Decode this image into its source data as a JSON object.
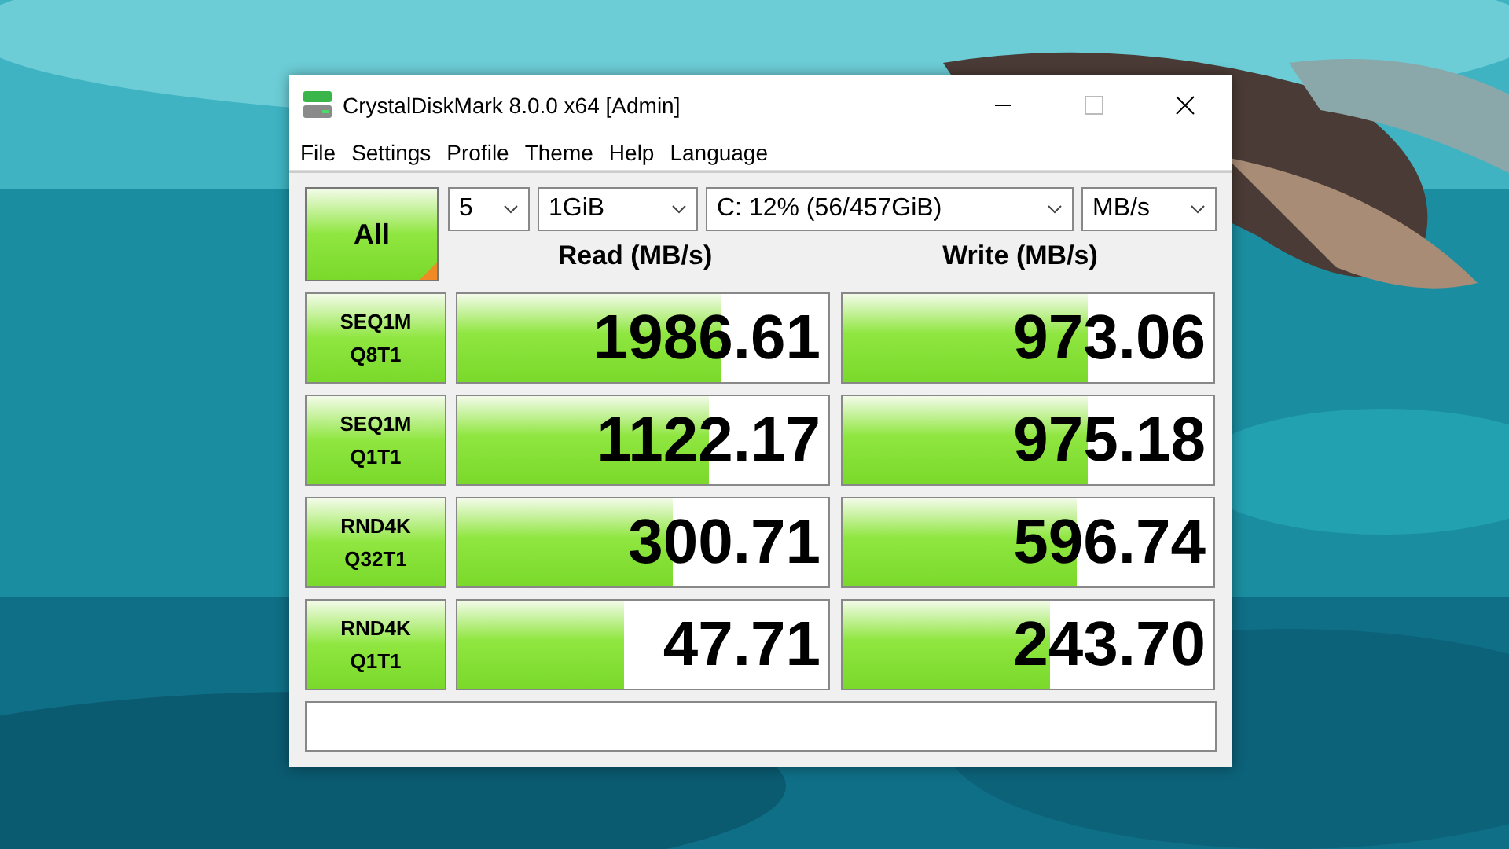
{
  "window": {
    "title": "CrystalDiskMark 8.0.0 x64 [Admin]"
  },
  "menu": [
    "File",
    "Settings",
    "Profile",
    "Theme",
    "Help",
    "Language"
  ],
  "all_button": "All",
  "settings": [
    {
      "value": "5"
    },
    {
      "value": "1GiB"
    },
    {
      "value": "C: 12% (56/457GiB)"
    },
    {
      "value": "MB/s"
    }
  ],
  "headers": {
    "read": "Read (MB/s)",
    "write": "Write (MB/s)"
  },
  "tests": [
    {
      "name": "SEQ1M",
      "params": "Q8T1",
      "read": {
        "value": "1986.61",
        "level": 0.71
      },
      "write": {
        "value": "973.06",
        "level": 0.66
      }
    },
    {
      "name": "SEQ1M",
      "params": "Q1T1",
      "read": {
        "value": "1122.17",
        "level": 0.68
      },
      "write": {
        "value": "975.18",
        "level": 0.66
      }
    },
    {
      "name": "RND4K",
      "params": "Q32T1",
      "read": {
        "value": "300.71",
        "level": 0.58
      },
      "write": {
        "value": "596.74",
        "level": 0.63
      }
    },
    {
      "name": "RND4K",
      "params": "Q1T1",
      "read": {
        "value": "47.71",
        "level": 0.45
      },
      "write": {
        "value": "243.70",
        "level": 0.56
      }
    }
  ]
}
